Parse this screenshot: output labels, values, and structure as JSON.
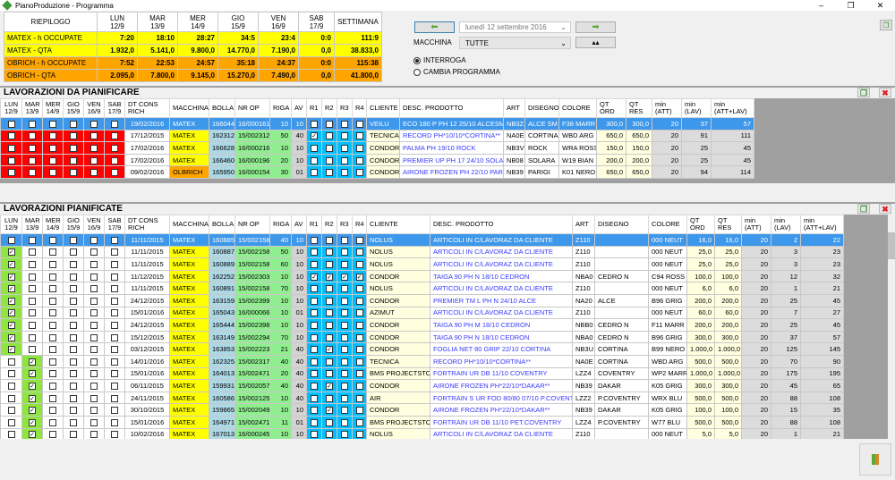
{
  "window": {
    "title": "PianoProduzione - Programma"
  },
  "summary": {
    "headers": [
      "RIEPILOGO",
      "LUN\n12/9",
      "MAR\n13/9",
      "MER\n14/9",
      "GIO\n15/9",
      "VEN\n16/9",
      "SAB\n17/9",
      "SETTIMANA"
    ],
    "rows": [
      {
        "label": "MATEX - h OCCUPATE",
        "values": [
          "7:20",
          "18:10",
          "28:27",
          "34:5",
          "23:4",
          "0:0",
          "111:9"
        ],
        "color": "#ffff00"
      },
      {
        "label": "MATEX - QTA",
        "values": [
          "1.932,0",
          "5.141,0",
          "9.800,0",
          "14.770,0",
          "7.190,0",
          "0,0",
          "38.833,0"
        ],
        "color": "#ffff00"
      },
      {
        "label": "OBRICH - h OCCUPATE",
        "values": [
          "7:52",
          "22:53",
          "24:57",
          "35:18",
          "24:37",
          "0:0",
          "115:38"
        ],
        "color": "#ffa500"
      },
      {
        "label": "OBRICH - QTA",
        "values": [
          "2.095,0",
          "7.800,0",
          "9.145,0",
          "15.270,0",
          "7.490,0",
          "0,0",
          "41.800,0"
        ],
        "color": "#ffa500"
      }
    ]
  },
  "controls": {
    "date": "lunedì    12 settembre 2016",
    "macchina_label": "MACCHINA",
    "macchina_value": "TUTTE",
    "radio_interroga": "INTERROGA",
    "radio_cambia": "CAMBIA PROGRAMMA",
    "selected_mode": "INTERROGA"
  },
  "columns": {
    "days": [
      "LUN\n12/9",
      "MAR\n13/9",
      "MER\n14/9",
      "GIO\n15/9",
      "VEN\n16/9",
      "SAB\n17/9"
    ],
    "dt": "DT CONS RICH",
    "macchina": "MACCHINA",
    "bolla": "BOLLA",
    "nr_op": "NR OP",
    "riga": "RIGA",
    "av": "AV",
    "r": [
      "R1",
      "R2",
      "R3",
      "R4"
    ],
    "cliente": "CLIENTE",
    "desc": "DESC. PRODOTTO",
    "art": "ART",
    "disegno": "DISEGNO",
    "colore": "COLORE",
    "qt_ord": "QT ORD",
    "qt_res": "QT RES",
    "min_att": "min (ATT)",
    "min_lav": "min (LAV)",
    "min_tot": "min (ATT+LAV)"
  },
  "da_pianificare": {
    "title": "LAVORAZIONI DA PIANIFICARE",
    "selected_row": 0,
    "rows": [
      {
        "days": [
          0,
          0,
          0,
          0,
          0,
          0
        ],
        "dt": "19/02/2016",
        "macchina": "MATEX",
        "bolla": "166044",
        "nr_op": "16/000161",
        "riga": "10",
        "av": "10",
        "r": [
          0,
          0,
          0,
          0
        ],
        "cliente": "VEILU",
        "desc": "ECO 180 P PH 12 25/10 ALCESM",
        "art": "NB3Z",
        "disegno": "ALCE SM",
        "colore": "F38 MARR",
        "qt_ord": "300,0",
        "qt_res": "300,0",
        "min_att": "20",
        "min_lav": "37",
        "min_tot": "57"
      },
      {
        "days": [
          0,
          0,
          0,
          0,
          0,
          0
        ],
        "dt": "17/12/2015",
        "macchina": "MATEX",
        "bolla": "162312",
        "nr_op": "15/002312",
        "riga": "50",
        "av": "40",
        "r": [
          1,
          0,
          0,
          0
        ],
        "cliente": "TECNICA",
        "desc": "RECORD PH*10/10*CORTINA**",
        "art": "NA0E",
        "disegno": "CORTINA",
        "colore": "WBD ARG",
        "qt_ord": "650,0",
        "qt_res": "650,0",
        "min_att": "20",
        "min_lav": "91",
        "min_tot": "111"
      },
      {
        "days": [
          0,
          0,
          0,
          0,
          0,
          0
        ],
        "dt": "17/02/2016",
        "macchina": "MATEX",
        "bolla": "166628",
        "nr_op": "16/000216",
        "riga": "10",
        "av": "10",
        "r": [
          0,
          0,
          0,
          0
        ],
        "cliente": "CONDOR",
        "desc": "PALMA PH 19/10 ROCK",
        "art": "NB3V",
        "disegno": "ROCK",
        "colore": "WRA ROSS",
        "qt_ord": "150,0",
        "qt_res": "150,0",
        "min_att": "20",
        "min_lav": "25",
        "min_tot": "45"
      },
      {
        "days": [
          0,
          0,
          0,
          0,
          0,
          0
        ],
        "dt": "17/02/2016",
        "macchina": "MATEX",
        "bolla": "166460",
        "nr_op": "16/000196",
        "riga": "20",
        "av": "10",
        "r": [
          0,
          0,
          0,
          0
        ],
        "cliente": "CONDOR",
        "desc": "PREMIER UP PH 17 24/10 SOLARA",
        "art": "NB08",
        "disegno": "SOLARA",
        "colore": "W19 BIAN",
        "qt_ord": "200,0",
        "qt_res": "200,0",
        "min_att": "20",
        "min_lav": "25",
        "min_tot": "45"
      },
      {
        "days": [
          0,
          0,
          0,
          0,
          0,
          0
        ],
        "dt": "09/02/2016",
        "macchina": "OLBRICH",
        "bolla": "165950",
        "nr_op": "16/000154",
        "riga": "30",
        "av": "01",
        "r": [
          0,
          0,
          0,
          0
        ],
        "cliente": "CONDOR",
        "desc": "AIRONE FROZEN PH 22/10 PARIGI",
        "art": "NB39",
        "disegno": "PARIGI",
        "colore": "K01 NERO",
        "qt_ord": "650,0",
        "qt_res": "650,0",
        "min_att": "20",
        "min_lav": "94",
        "min_tot": "114"
      }
    ]
  },
  "pianificate": {
    "title": "LAVORAZIONI PIANIFICATE",
    "selected_row": 0,
    "rows": [
      {
        "days": [
          1,
          0,
          0,
          0,
          0,
          0
        ],
        "dt": "11/11/2015",
        "macchina": "MATEX",
        "bolla": "160885",
        "nr_op": "15/002158",
        "riga": "40",
        "av": "10",
        "r": [
          0,
          0,
          0,
          0
        ],
        "cliente": "NOLUS",
        "desc": "ARTICOLI IN C/LAVORAZ DA CLIENTE",
        "art": "Z110",
        "disegno": "",
        "colore": "000 NEUT",
        "qt_ord": "16,0",
        "qt_res": "16,0",
        "min_att": "20",
        "min_lav": "2",
        "min_tot": "22"
      },
      {
        "days": [
          1,
          0,
          0,
          0,
          0,
          0
        ],
        "dt": "11/11/2015",
        "macchina": "MATEX",
        "bolla": "160887",
        "nr_op": "15/002158",
        "riga": "50",
        "av": "10",
        "r": [
          0,
          0,
          0,
          0
        ],
        "cliente": "NOLUS",
        "desc": "ARTICOLI IN C/LAVORAZ DA CLIENTE",
        "art": "Z110",
        "disegno": "",
        "colore": "000 NEUT",
        "qt_ord": "25,0",
        "qt_res": "25,0",
        "min_att": "20",
        "min_lav": "3",
        "min_tot": "23"
      },
      {
        "days": [
          1,
          0,
          0,
          0,
          0,
          0
        ],
        "dt": "11/11/2015",
        "macchina": "MATEX",
        "bolla": "160889",
        "nr_op": "15/002158",
        "riga": "60",
        "av": "10",
        "r": [
          0,
          0,
          0,
          0
        ],
        "cliente": "NOLUS",
        "desc": "ARTICOLI IN C/LAVORAZ DA CLIENTE",
        "art": "Z110",
        "disegno": "",
        "colore": "000 NEUT",
        "qt_ord": "25,0",
        "qt_res": "25,0",
        "min_att": "20",
        "min_lav": "3",
        "min_tot": "23"
      },
      {
        "days": [
          1,
          0,
          0,
          0,
          0,
          0
        ],
        "dt": "11/12/2015",
        "macchina": "MATEX",
        "bolla": "162252",
        "nr_op": "15/002303",
        "riga": "10",
        "av": "10",
        "r": [
          1,
          1,
          1,
          1
        ],
        "cliente": "CONDOR",
        "desc": "TAIGA 90 PH N 18/10 CEDRON",
        "art": "NBA0",
        "disegno": "CEDRO N",
        "colore": "C94 ROSS",
        "qt_ord": "100,0",
        "qt_res": "100,0",
        "min_att": "20",
        "min_lav": "12",
        "min_tot": "32"
      },
      {
        "days": [
          1,
          0,
          0,
          0,
          0,
          0
        ],
        "dt": "11/11/2015",
        "macchina": "MATEX",
        "bolla": "160891",
        "nr_op": "15/002158",
        "riga": "70",
        "av": "10",
        "r": [
          0,
          0,
          0,
          0
        ],
        "cliente": "NOLUS",
        "desc": "ARTICOLI IN C/LAVORAZ DA CLIENTE",
        "art": "Z110",
        "disegno": "",
        "colore": "000 NEUT",
        "qt_ord": "6,0",
        "qt_res": "6,0",
        "min_att": "20",
        "min_lav": "1",
        "min_tot": "21"
      },
      {
        "days": [
          1,
          0,
          0,
          0,
          0,
          0
        ],
        "dt": "24/12/2015",
        "macchina": "MATEX",
        "bolla": "163159",
        "nr_op": "15/002399",
        "riga": "10",
        "av": "10",
        "r": [
          0,
          0,
          0,
          0
        ],
        "cliente": "CONDOR",
        "desc": "PREMIER TM L PH N 24/10 ALCE",
        "art": "NA20",
        "disegno": "ALCE",
        "colore": "B96 GRIG",
        "qt_ord": "200,0",
        "qt_res": "200,0",
        "min_att": "20",
        "min_lav": "25",
        "min_tot": "45"
      },
      {
        "days": [
          1,
          0,
          0,
          0,
          0,
          0
        ],
        "dt": "15/01/2016",
        "macchina": "MATEX",
        "bolla": "165043",
        "nr_op": "16/000066",
        "riga": "10",
        "av": "01",
        "r": [
          0,
          0,
          0,
          0
        ],
        "cliente": "AZIMUT",
        "desc": "ARTICOLI IN C/LAVORAZ DA CLIENTE",
        "art": "Z110",
        "disegno": "",
        "colore": "000 NEUT",
        "qt_ord": "60,0",
        "qt_res": "60,0",
        "min_att": "20",
        "min_lav": "7",
        "min_tot": "27"
      },
      {
        "days": [
          1,
          0,
          0,
          0,
          0,
          0
        ],
        "dt": "24/12/2015",
        "macchina": "MATEX",
        "bolla": "165444",
        "nr_op": "15/002398",
        "riga": "10",
        "av": "10",
        "r": [
          0,
          0,
          0,
          0
        ],
        "cliente": "CONDOR",
        "desc": "TAIGA 90 PH M 18/10 CEDRON",
        "art": "NBB0",
        "disegno": "CEDRO N",
        "colore": "F11 MARR",
        "qt_ord": "200,0",
        "qt_res": "200,0",
        "min_att": "20",
        "min_lav": "25",
        "min_tot": "45"
      },
      {
        "days": [
          1,
          0,
          0,
          0,
          0,
          0
        ],
        "dt": "15/12/2015",
        "macchina": "MATEX",
        "bolla": "163149",
        "nr_op": "15/002294",
        "riga": "70",
        "av": "10",
        "r": [
          0,
          0,
          0,
          0
        ],
        "cliente": "CONDOR",
        "desc": "TAIGA 90 PH N 18/10 CEDRON",
        "art": "NBA0",
        "disegno": "CEDRO N",
        "colore": "B96 GRIG",
        "qt_ord": "300,0",
        "qt_res": "300,0",
        "min_att": "20",
        "min_lav": "37",
        "min_tot": "57"
      },
      {
        "days": [
          1,
          0,
          0,
          0,
          0,
          0
        ],
        "dt": "03/12/2015",
        "macchina": "MATEX",
        "bolla": "163853",
        "nr_op": "15/002223",
        "riga": "21",
        "av": "40",
        "r": [
          0,
          1,
          0,
          0
        ],
        "cliente": "CONDOR",
        "desc": "FOGLIA NET 80 GRIP 22/10 CORTINA",
        "art": "NB3U",
        "disegno": "CORTINA",
        "colore": "B99 NERO",
        "qt_ord": "1.000,0",
        "qt_res": "1.000,0",
        "min_att": "20",
        "min_lav": "125",
        "min_tot": "145"
      },
      {
        "days": [
          0,
          1,
          0,
          0,
          0,
          0
        ],
        "dt": "14/01/2016",
        "macchina": "MATEX",
        "bolla": "162325",
        "nr_op": "15/002317",
        "riga": "40",
        "av": "40",
        "r": [
          0,
          0,
          0,
          0
        ],
        "cliente": "TECNICA",
        "desc": "RECORD PH*10/10*CORTINA**",
        "art": "NA0E",
        "disegno": "CORTINA",
        "colore": "WBD ARG",
        "qt_ord": "500,0",
        "qt_res": "500,0",
        "min_att": "20",
        "min_lav": "70",
        "min_tot": "90"
      },
      {
        "days": [
          0,
          1,
          0,
          0,
          0,
          0
        ],
        "dt": "15/01/2016",
        "macchina": "MATEX",
        "bolla": "164013",
        "nr_op": "15/002471",
        "riga": "20",
        "av": "40",
        "r": [
          0,
          0,
          0,
          0
        ],
        "cliente": "BMS PROJECTSTOF",
        "desc": "FORTRAIN UR DB 11/10 COVENTRY",
        "art": "LZZ4",
        "disegno": "COVENTRY",
        "colore": "WP2 MARR",
        "qt_ord": "1.000,0",
        "qt_res": "1.000,0",
        "min_att": "20",
        "min_lav": "175",
        "min_tot": "195"
      },
      {
        "days": [
          0,
          1,
          0,
          0,
          0,
          0
        ],
        "dt": "06/11/2015",
        "macchina": "MATEX",
        "bolla": "159931",
        "nr_op": "15/002057",
        "riga": "40",
        "av": "40",
        "r": [
          0,
          1,
          0,
          0
        ],
        "cliente": "CONDOR",
        "desc": "AIRONE FROZEN PH*22/10*DAKAR**",
        "art": "NB39",
        "disegno": "DAKAR",
        "colore": "K05 GRIG",
        "qt_ord": "300,0",
        "qt_res": "300,0",
        "min_att": "20",
        "min_lav": "45",
        "min_tot": "65"
      },
      {
        "days": [
          0,
          1,
          0,
          0,
          0,
          0
        ],
        "dt": "24/11/2015",
        "macchina": "MATEX",
        "bolla": "160586",
        "nr_op": "15/002125",
        "riga": "10",
        "av": "40",
        "r": [
          0,
          0,
          0,
          0
        ],
        "cliente": "AIR",
        "desc": "FORTRAIN S UR FOD 80/80 07/10 P.COVENTRY",
        "art": "LZZ2",
        "disegno": "P.COVENTRY",
        "colore": "WRX BLU",
        "qt_ord": "500,0",
        "qt_res": "500,0",
        "min_att": "20",
        "min_lav": "88",
        "min_tot": "108"
      },
      {
        "days": [
          0,
          1,
          0,
          0,
          0,
          0
        ],
        "dt": "30/10/2015",
        "macchina": "MATEX",
        "bolla": "159865",
        "nr_op": "15/002049",
        "riga": "10",
        "av": "10",
        "r": [
          0,
          1,
          0,
          0
        ],
        "cliente": "CONDOR",
        "desc": "AIRONE FROZEN PH*22/10*DAKAR**",
        "art": "NB39",
        "disegno": "DAKAR",
        "colore": "K05 GRIG",
        "qt_ord": "100,0",
        "qt_res": "100,0",
        "min_att": "20",
        "min_lav": "15",
        "min_tot": "35"
      },
      {
        "days": [
          0,
          1,
          0,
          0,
          0,
          0
        ],
        "dt": "15/01/2016",
        "macchina": "MATEX",
        "bolla": "164971",
        "nr_op": "15/002471",
        "riga": "11",
        "av": "01",
        "r": [
          0,
          0,
          0,
          0
        ],
        "cliente": "BMS PROJECTSTOF",
        "desc": "FORTRAIN UR DB 11/10 PET.COVENTRY",
        "art": "LZZ4",
        "disegno": "P.COVENTRY",
        "colore": "W77 BLU",
        "qt_ord": "500,0",
        "qt_res": "500,0",
        "min_att": "20",
        "min_lav": "88",
        "min_tot": "108"
      },
      {
        "days": [
          0,
          1,
          0,
          0,
          0,
          0
        ],
        "dt": "10/02/2016",
        "macchina": "MATEX",
        "bolla": "167013",
        "nr_op": "16/000245",
        "riga": "10",
        "av": "10",
        "r": [
          0,
          0,
          0,
          0
        ],
        "cliente": "NOLUS",
        "desc": "ARTICOLI IN C/LAVORAZ DA CLIENTE",
        "art": "Z110",
        "disegno": "",
        "colore": "000 NEUT",
        "qt_ord": "5,0",
        "qt_res": "5,0",
        "min_att": "20",
        "min_lav": "1",
        "min_tot": "21"
      }
    ]
  },
  "icons": {
    "prev": "arrow-left-icon",
    "next": "arrow-right-icon",
    "search": "binoculars-icon",
    "restore": "restore-window-icon",
    "close": "close-icon",
    "exit": "exit-door-icon"
  }
}
